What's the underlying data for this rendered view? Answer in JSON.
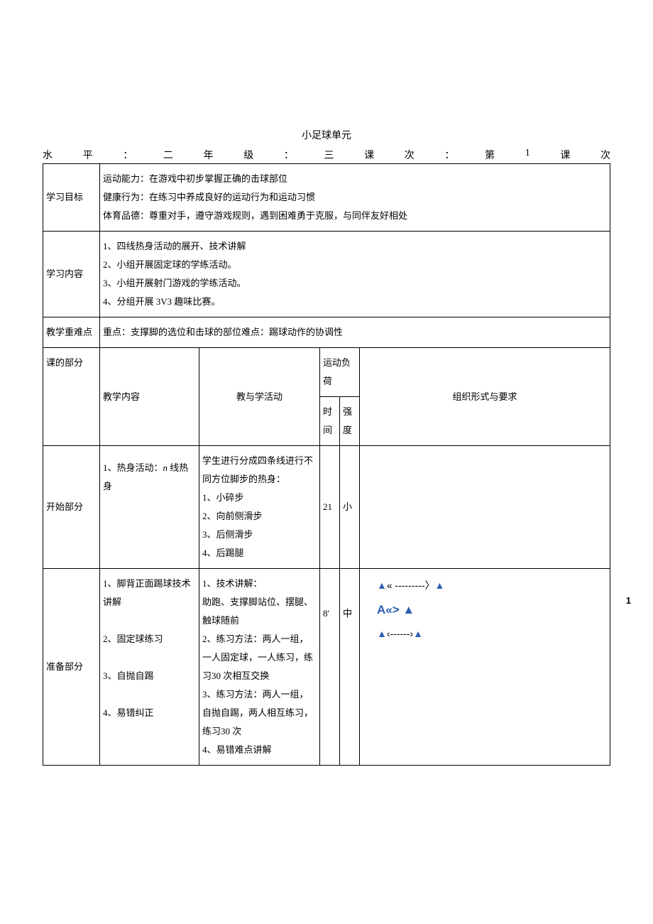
{
  "title": "小足球单元",
  "meta": {
    "level_label": "水",
    "level_label2": "平",
    "colon1": "：",
    "level_value": "二",
    "grade_label": "年",
    "grade_label2": "级",
    "colon2": "：",
    "grade_value": "三",
    "lesson_label": "课",
    "lesson_label2": "次",
    "colon3": "：",
    "lesson_prefix": "第",
    "lesson_num": "1",
    "lesson_label3": "课",
    "lesson_label4": "次"
  },
  "rows": {
    "objectives": {
      "label": "学习目标",
      "line1": "运动能力：在游戏中初步掌握正确的击球部位",
      "line2": "健康行为：在练习中养成良好的运动行为和运动习惯",
      "line3": "体育品德：尊重对手，遵守游戏规则，遇到困难勇于克服，与同伴友好相处"
    },
    "content": {
      "label": "学习内容",
      "line1": "1、四线热身活动的展开、技术讲解",
      "line2": "2、小组开展固定球的学练活动。",
      "line3": "3、小组开展射门游戏的学练活动。",
      "line4": "4、分组开展 3V3 趣味比赛。"
    },
    "keypoints": {
      "label": "教学重难点",
      "text": "重点：支撑脚的选位和击球的部位难点：踢球动作的协调性"
    },
    "header": {
      "c1": "课的部分",
      "c2": "教学内容",
      "c3": "教与学活动",
      "c4": "运动负荷",
      "c4a": "时间",
      "c4b": "强度",
      "c5": "组织形式与要求"
    },
    "start": {
      "label": "开始部分",
      "content_prefix": "1、热身活动：",
      "content_italic": "n",
      "content_suffix": " 线热身",
      "activity": "学生进行分成四条线进行不同方位脚步的热身：\n1、小碎步\n2、向前侧滑步\n3、后侧滑步\n4、后踢腿",
      "time": "21",
      "intensity": "小",
      "org": ""
    },
    "prep": {
      "label": "准备部分",
      "content": "1、脚背正面踢球技术讲解\n\n2、固定球练习\n\n3、自抛自踢\n\n4、易错纠正",
      "activity": "1、技术讲解：\n助跑、支撑脚站位、摆腿、触球随前\n2、练习方法：两人一组，一人固定球，一人练习，练习30 次相互交换\n3、练习方法：两人一组，自抛自踢，两人相互练习，练习30 次\n4、易错难点讲解",
      "time": "8'",
      "intensity": "中",
      "org_line1_a": "▲",
      "org_line1_b": "« ---------〉",
      "org_line1_c": "▲",
      "org_line2_a": "A",
      "org_line2_b": "«>",
      "org_line2_c": "▲",
      "org_line3_a": "▲",
      "org_line3_b": "‹------›",
      "org_line3_c": "▲",
      "side_num": "1"
    }
  }
}
